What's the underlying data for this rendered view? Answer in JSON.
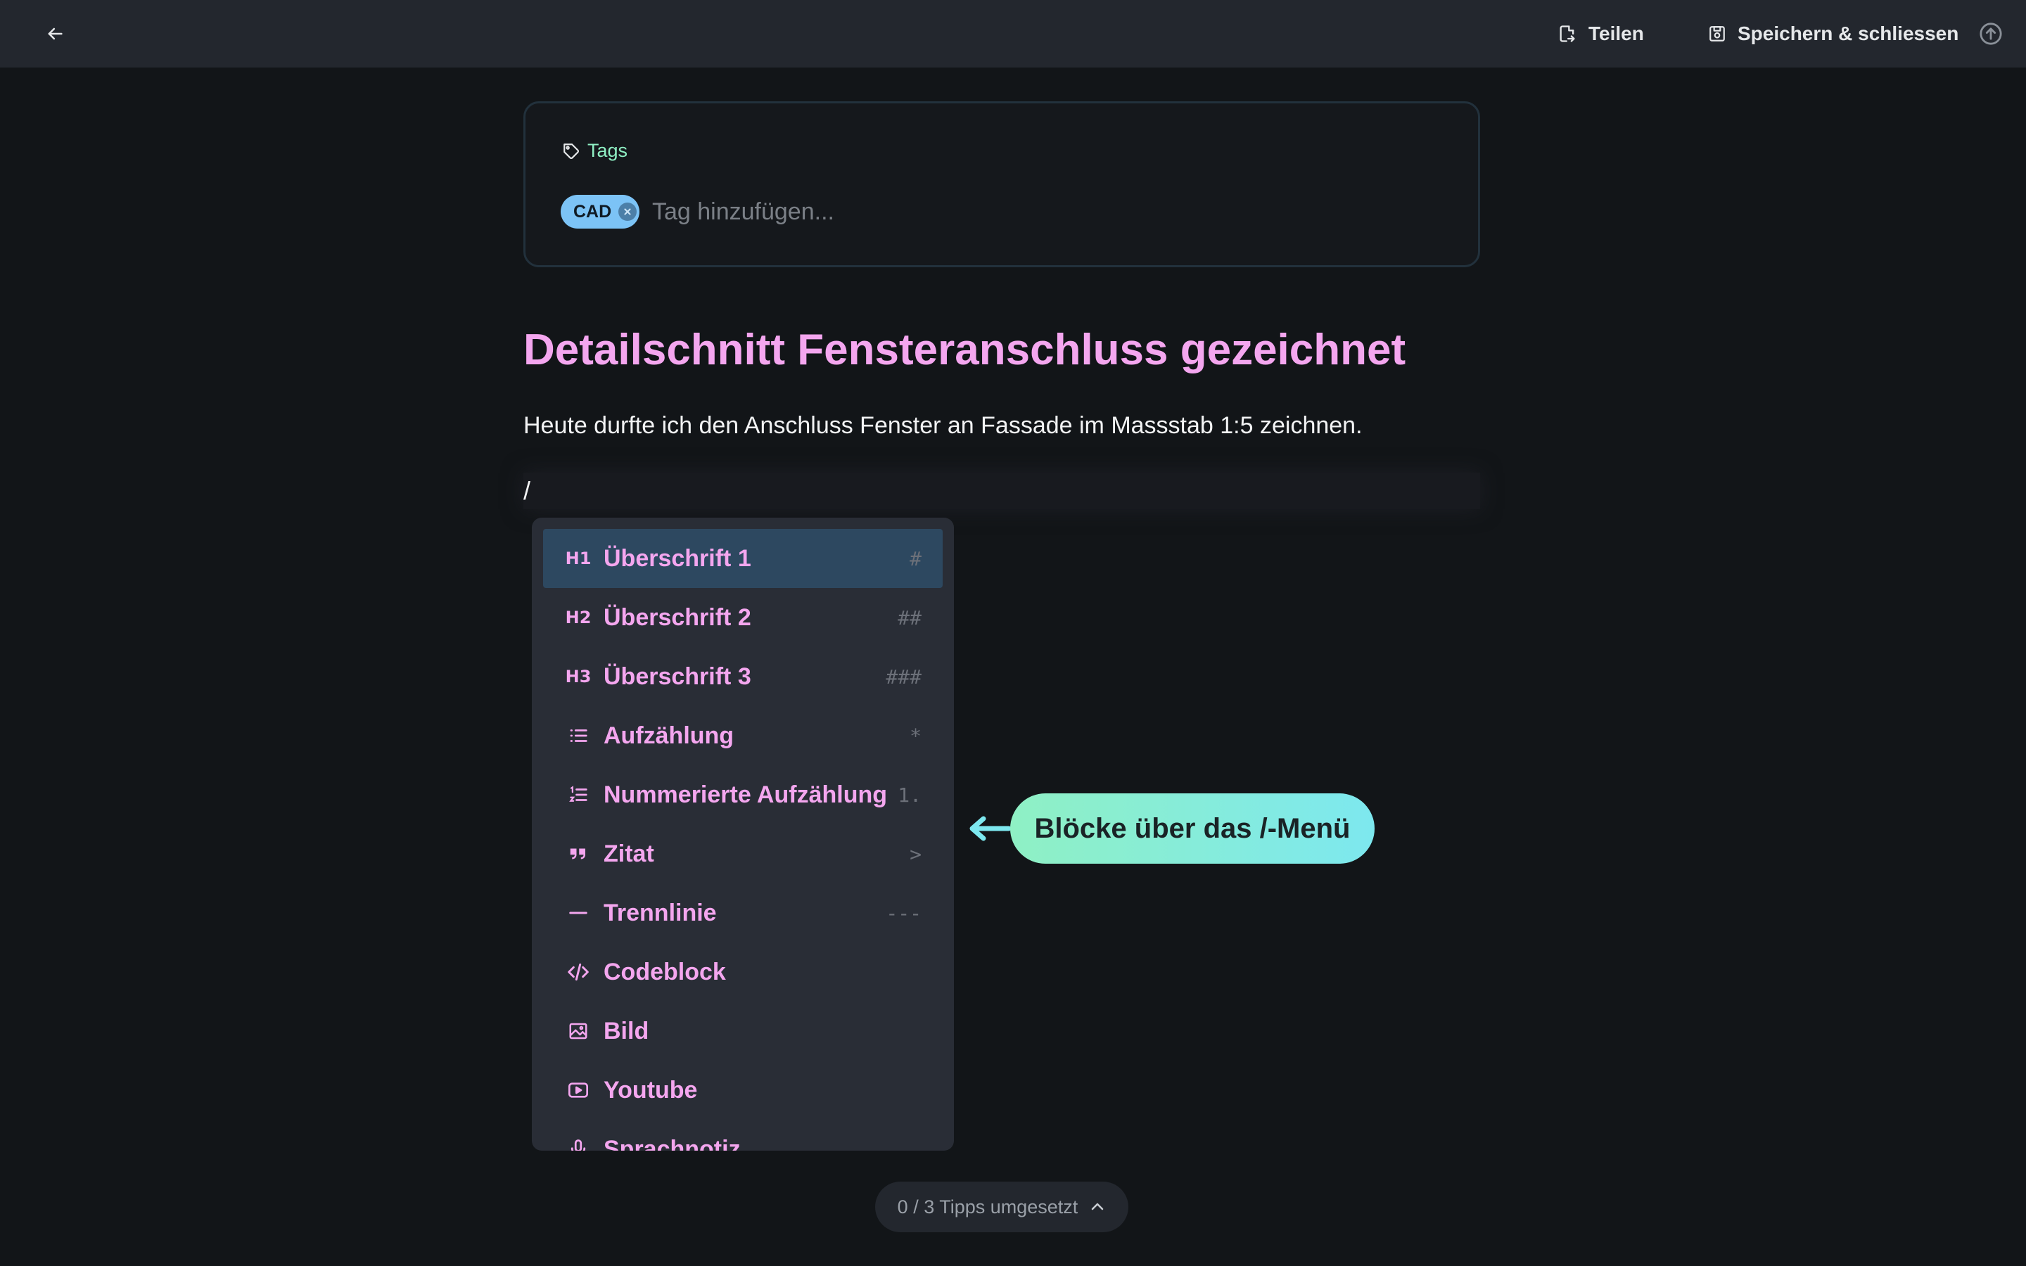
{
  "topbar": {
    "share_label": "Teilen",
    "save_label": "Speichern & schliessen"
  },
  "tags": {
    "label": "Tags",
    "chips": [
      "CAD"
    ],
    "input_placeholder": "Tag hinzufügen..."
  },
  "document": {
    "title": "Detailschnitt Fensteranschluss gezeichnet",
    "paragraph": "Heute durfte ich den Anschluss Fenster an Fassade im Massstab 1:5 zeichnen.",
    "current_line": "/"
  },
  "slash_menu": {
    "items": [
      {
        "label": "Überschrift 1",
        "shortcut": "#",
        "icon": "H1"
      },
      {
        "label": "Überschrift 2",
        "shortcut": "##",
        "icon": "H2"
      },
      {
        "label": "Überschrift 3",
        "shortcut": "###",
        "icon": "H3"
      },
      {
        "label": "Aufzählung",
        "shortcut": "*",
        "icon": "list-icon"
      },
      {
        "label": "Nummerierte Aufzählung",
        "shortcut": "1.",
        "icon": "numbered-list-icon"
      },
      {
        "label": "Zitat",
        "shortcut": ">",
        "icon": "quote-icon"
      },
      {
        "label": "Trennlinie",
        "shortcut": "---",
        "icon": "divider-icon"
      },
      {
        "label": "Codeblock",
        "shortcut": "",
        "icon": "code-icon"
      },
      {
        "label": "Bild",
        "shortcut": "",
        "icon": "image-icon"
      },
      {
        "label": "Youtube",
        "shortcut": "",
        "icon": "youtube-icon"
      },
      {
        "label": "Sprachnotiz",
        "shortcut": "",
        "icon": "microphone-icon"
      }
    ]
  },
  "callout": {
    "text": "Blöcke über das /-Menü"
  },
  "tips": {
    "text": "0 / 3 Tipps umgesetzt"
  },
  "colors": {
    "accent_pink": "#f4a6ef",
    "accent_mint": "#8ff0c4",
    "chip_blue": "#7cc3f6",
    "active_row": "#2d4860"
  }
}
